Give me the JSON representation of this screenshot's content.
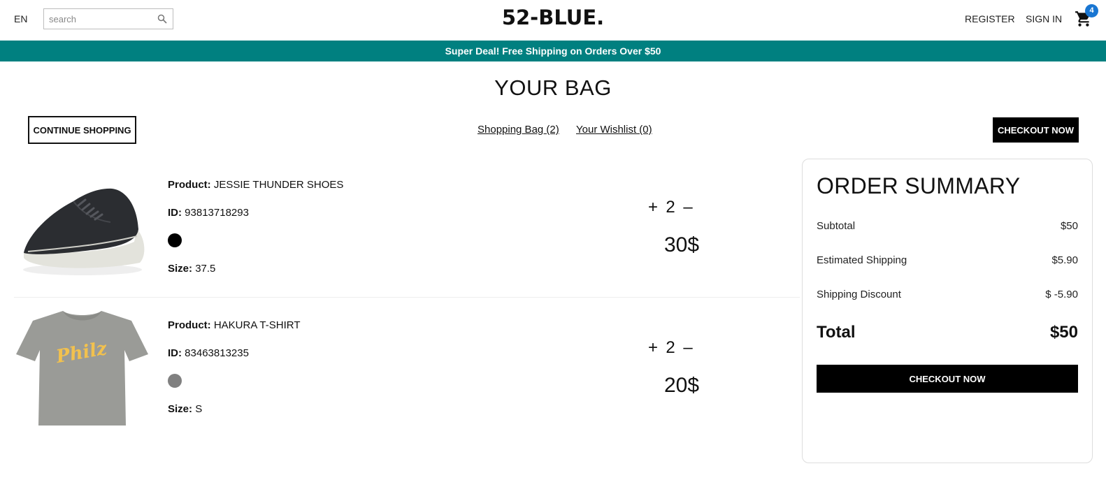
{
  "navbar": {
    "language": "EN",
    "search_placeholder": "search",
    "logo": "52-BLUE.",
    "register": "REGISTER",
    "sign_in": "SIGN IN",
    "cart_count": "4"
  },
  "announcement": "Super Deal! Free Shipping on Orders Over $50",
  "page_title": "YOUR BAG",
  "top": {
    "continue_label": "CONTINUE SHOPPING",
    "shopping_bag": "Shopping Bag (2)",
    "wishlist": "Your Wishlist (0)",
    "checkout_label": "CHECKOUT NOW"
  },
  "labels": {
    "product": "Product:",
    "id": "ID:",
    "size": "Size:"
  },
  "products": [
    {
      "name": "JESSIE THUNDER SHOES",
      "id": "93813718293",
      "color": "#000000",
      "size": "37.5",
      "quantity": "2",
      "price": "30$",
      "plus": "+",
      "minus": "–",
      "image_icon": "shoe-image"
    },
    {
      "name": "HAKURA T-SHIRT",
      "id": "83463813235",
      "color": "#808080",
      "size": "S",
      "quantity": "2",
      "price": "20$",
      "plus": "+",
      "minus": "–",
      "image_icon": "tshirt-image",
      "image_text": "Philz"
    }
  ],
  "summary": {
    "title": "ORDER SUMMARY",
    "subtotal_label": "Subtotal",
    "subtotal": "$50",
    "shipping_label": "Estimated Shipping",
    "shipping": "$5.90",
    "discount_label": "Shipping Discount",
    "discount": "$ -5.90",
    "total_label": "Total",
    "total": "$50",
    "checkout_label": "CHECKOUT NOW"
  },
  "colors": {
    "announcement_bg": "#008080",
    "badge_bg": "#1976d2",
    "button_bg": "#000000"
  }
}
